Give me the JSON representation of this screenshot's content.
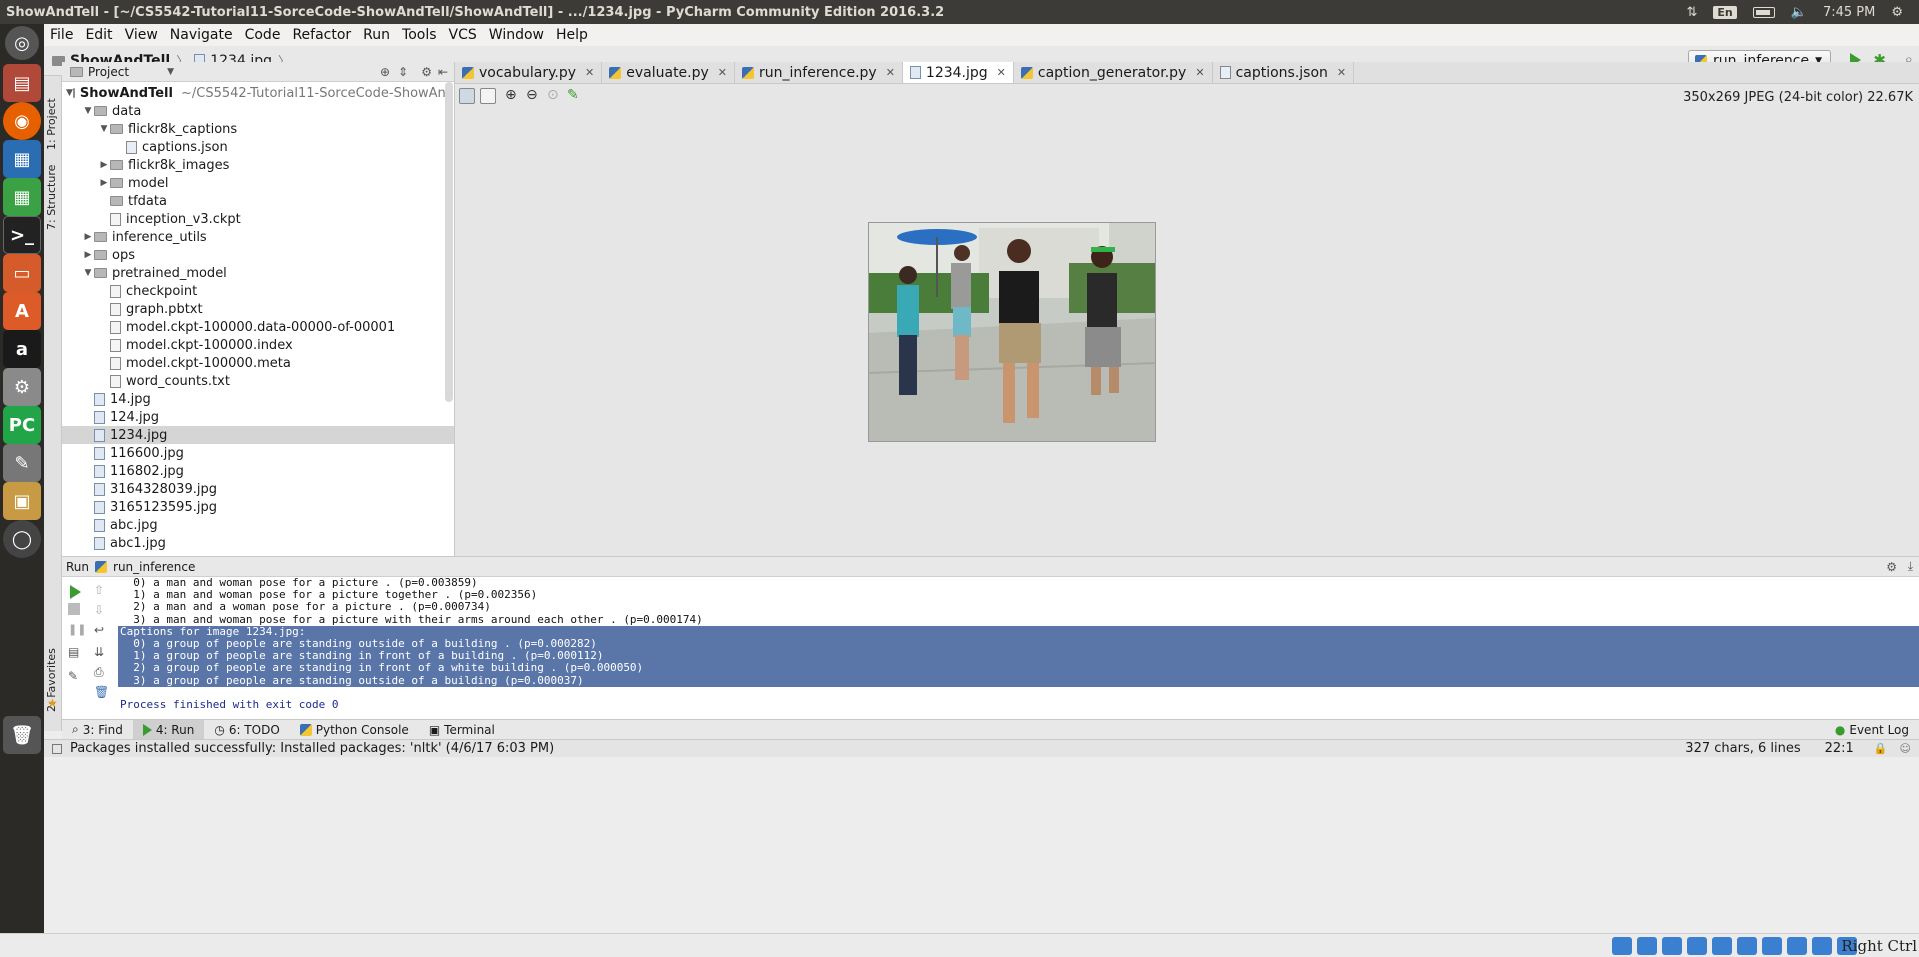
{
  "window_title": "ShowAndTell - [~/CS5542-Tutorial11-SorceCode-ShowAndTell/ShowAndTell] - .../1234.jpg - PyCharm Community Edition 2016.3.2",
  "topbar": {
    "lang": "En",
    "time": "7:45 PM"
  },
  "menu": [
    "File",
    "Edit",
    "View",
    "Navigate",
    "Code",
    "Refactor",
    "Run",
    "Tools",
    "VCS",
    "Window",
    "Help"
  ],
  "breadcrumb": {
    "project": "ShowAndTell",
    "file": "1234.jpg"
  },
  "run_config": "run_inference",
  "side_tabs": {
    "project": "1: Project",
    "structure": "7: Structure",
    "favorites": "2: Favorites"
  },
  "project_panel": {
    "title": "Project",
    "root_name": "ShowAndTell",
    "root_path": "~/CS5542-Tutorial11-SorceCode-ShowAndTell/Sho",
    "items": [
      {
        "label": "data",
        "kind": "dir"
      },
      {
        "label": "flickr8k_captions",
        "kind": "dir"
      },
      {
        "label": "captions.json",
        "kind": "json"
      },
      {
        "label": "flickr8k_images",
        "kind": "dir"
      },
      {
        "label": "model",
        "kind": "dir"
      },
      {
        "label": "tfdata",
        "kind": "dir"
      },
      {
        "label": "inception_v3.ckpt",
        "kind": "file"
      },
      {
        "label": "inference_utils",
        "kind": "dir"
      },
      {
        "label": "ops",
        "kind": "dir"
      },
      {
        "label": "pretrained_model",
        "kind": "dir"
      },
      {
        "label": "checkpoint",
        "kind": "file"
      },
      {
        "label": "graph.pbtxt",
        "kind": "file"
      },
      {
        "label": "model.ckpt-100000.data-00000-of-00001",
        "kind": "file"
      },
      {
        "label": "model.ckpt-100000.index",
        "kind": "file"
      },
      {
        "label": "model.ckpt-100000.meta",
        "kind": "file"
      },
      {
        "label": "word_counts.txt",
        "kind": "file"
      },
      {
        "label": "14.jpg",
        "kind": "img"
      },
      {
        "label": "124.jpg",
        "kind": "img"
      },
      {
        "label": "1234.jpg",
        "kind": "img"
      },
      {
        "label": "116600.jpg",
        "kind": "img"
      },
      {
        "label": "116802.jpg",
        "kind": "img"
      },
      {
        "label": "3164328039.jpg",
        "kind": "img"
      },
      {
        "label": "3165123595.jpg",
        "kind": "img"
      },
      {
        "label": "abc.jpg",
        "kind": "img"
      },
      {
        "label": "abc1.jpg",
        "kind": "img"
      }
    ]
  },
  "tabs": [
    {
      "label": "vocabulary.py",
      "kind": "py"
    },
    {
      "label": "evaluate.py",
      "kind": "py"
    },
    {
      "label": "run_inference.py",
      "kind": "py"
    },
    {
      "label": "1234.jpg",
      "kind": "jpg",
      "active": true
    },
    {
      "label": "caption_generator.py",
      "kind": "py"
    },
    {
      "label": "captions.json",
      "kind": "json"
    }
  ],
  "image_info": "350x269 JPEG (24-bit color) 22.67K",
  "run_panel": {
    "header_label": "Run",
    "config": "run_inference",
    "lines": [
      "  0) a man and woman pose for a picture . (p=0.003859)",
      "  1) a man and woman pose for a picture together . (p=0.002356)",
      "  2) a man and a woman pose for a picture . (p=0.000734)",
      "  3) a man and woman pose for a picture with their arms around each other . (p=0.000174)",
      "Captions for image 1234.jpg:",
      "  0) a group of people are standing outside of a building . (p=0.000282)",
      "  1) a group of people are standing in front of a building . (p=0.000112)",
      "  2) a group of people are standing in front of a white building . (p=0.000050)",
      "  3) a group of people are standing outside of a building (p=0.000037)",
      "",
      "Process finished with exit code 0"
    ]
  },
  "tool_tabs": {
    "find": "3: Find",
    "run": "4: Run",
    "todo": "6: TODO",
    "console": "Python Console",
    "terminal": "Terminal",
    "event_log": "Event Log"
  },
  "status": {
    "message": "Packages installed successfully: Installed packages: 'nltk' (4/6/17 6:03 PM)",
    "chars": "327 chars, 6 lines",
    "position": "22:1"
  },
  "systray": {
    "right_ctrl": "Right Ctrl"
  },
  "colors": {
    "selection": "#5a75a8",
    "run_green": "#3a9b2e"
  }
}
